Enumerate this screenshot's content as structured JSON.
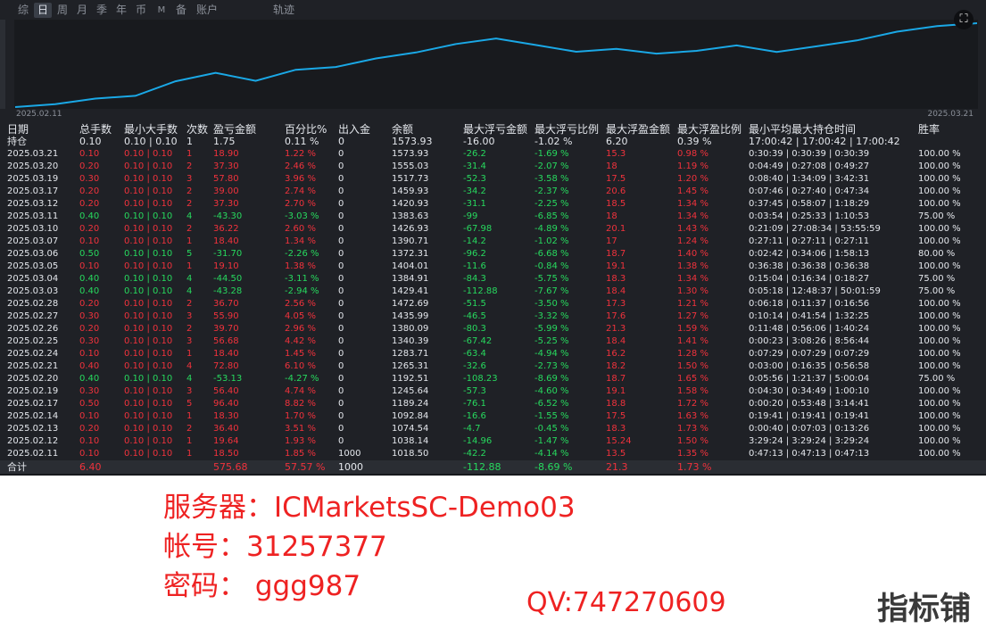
{
  "tabs": [
    {
      "label": "综",
      "active": false
    },
    {
      "label": "日",
      "active": true
    },
    {
      "label": "周",
      "active": false
    },
    {
      "label": "月",
      "active": false
    },
    {
      "label": "季",
      "active": false
    },
    {
      "label": "年",
      "active": false
    },
    {
      "label": "币",
      "active": false
    },
    {
      "label": "M",
      "active": false
    },
    {
      "label": "备",
      "active": false
    },
    {
      "label": "账户",
      "active": false
    }
  ],
  "chart_title": "轨迹",
  "chart_start_date": "2025.02.11",
  "chart_end_date": "2025.03.21",
  "expand_icon": "expand-icon",
  "chart_data": {
    "type": "line",
    "x": [
      "2025.02.11",
      "2025.02.12",
      "2025.02.13",
      "2025.02.14",
      "2025.02.17",
      "2025.02.19",
      "2025.02.20",
      "2025.02.21",
      "2025.02.24",
      "2025.02.25",
      "2025.02.26",
      "2025.02.27",
      "2025.02.28",
      "2025.03.03",
      "2025.03.04",
      "2025.03.05",
      "2025.03.06",
      "2025.03.07",
      "2025.03.10",
      "2025.03.11",
      "2025.03.12",
      "2025.03.17",
      "2025.03.19",
      "2025.03.20",
      "2025.03.21"
    ],
    "values": [
      1018.5,
      1038.14,
      1074.54,
      1092.84,
      1189.24,
      1245.64,
      1192.51,
      1265.31,
      1283.71,
      1340.39,
      1380.09,
      1435.99,
      1472.69,
      1429.41,
      1384.91,
      1404.01,
      1372.31,
      1390.71,
      1426.93,
      1383.63,
      1420.93,
      1459.93,
      1517.73,
      1555.03,
      1573.93
    ],
    "color": "#1aa8e6",
    "grid": false
  },
  "table": {
    "headers": [
      "日期",
      "总手数",
      "最小大手数",
      "次数",
      "盈亏金额",
      "百分比%",
      "出入金",
      "余额",
      "最大浮亏金额",
      "最大浮亏比例",
      "最大浮盈金额",
      "最大浮盈比例",
      "最小平均最大持仓时间",
      "胜率"
    ],
    "holding": [
      "持仓",
      "0.10",
      "0.10 | 0.10",
      "1",
      "1.75",
      "0.11 %",
      "0",
      "1573.93",
      "-16.00",
      "-1.02 %",
      "6.20",
      "0.39 %",
      "17:00:42 | 17:00:42 | 17:00:42",
      ""
    ],
    "rows": [
      [
        "2025.03.21",
        "0.10",
        "0.10 | 0.10",
        "1",
        "18.90",
        "1.22 %",
        "0",
        "1573.93",
        "-26.2",
        "-1.69 %",
        "15.3",
        "0.98 %",
        "0:30:39 | 0:30:39 | 0:30:39",
        "100.00 %"
      ],
      [
        "2025.03.20",
        "0.20",
        "0.10 | 0.10",
        "2",
        "37.30",
        "2.46 %",
        "0",
        "1555.03",
        "-31.4",
        "-2.07 %",
        "18",
        "1.19 %",
        "0:04:49 | 0:27:08 | 0:49:27",
        "100.00 %"
      ],
      [
        "2025.03.19",
        "0.30",
        "0.10 | 0.10",
        "3",
        "57.80",
        "3.96 %",
        "0",
        "1517.73",
        "-52.3",
        "-3.58 %",
        "17.5",
        "1.20 %",
        "0:08:40 | 1:34:09 | 3:42:31",
        "100.00 %"
      ],
      [
        "2025.03.17",
        "0.20",
        "0.10 | 0.10",
        "2",
        "39.00",
        "2.74 %",
        "0",
        "1459.93",
        "-34.2",
        "-2.37 %",
        "20.6",
        "1.45 %",
        "0:07:46 | 0:27:40 | 0:47:34",
        "100.00 %"
      ],
      [
        "2025.03.12",
        "0.20",
        "0.10 | 0.10",
        "2",
        "37.30",
        "2.70 %",
        "0",
        "1420.93",
        "-31.1",
        "-2.25 %",
        "18.5",
        "1.34 %",
        "0:37:45 | 0:58:07 | 1:18:29",
        "100.00 %"
      ],
      [
        "2025.03.11",
        "0.40",
        "0.10 | 0.10",
        "4",
        "-43.30",
        "-3.03 %",
        "0",
        "1383.63",
        "-99",
        "-6.85 %",
        "18",
        "1.34 %",
        "0:03:54 | 0:25:33 | 1:10:53",
        "75.00 %"
      ],
      [
        "2025.03.10",
        "0.20",
        "0.10 | 0.10",
        "2",
        "36.22",
        "2.60 %",
        "0",
        "1426.93",
        "-67.98",
        "-4.89 %",
        "20.1",
        "1.43 %",
        "0:21:09 | 27:08:34 | 53:55:59",
        "100.00 %"
      ],
      [
        "2025.03.07",
        "0.10",
        "0.10 | 0.10",
        "1",
        "18.40",
        "1.34 %",
        "0",
        "1390.71",
        "-14.2",
        "-1.02 %",
        "17",
        "1.24 %",
        "0:27:11 | 0:27:11 | 0:27:11",
        "100.00 %"
      ],
      [
        "2025.03.06",
        "0.50",
        "0.10 | 0.10",
        "5",
        "-31.70",
        "-2.26 %",
        "0",
        "1372.31",
        "-96.2",
        "-6.68 %",
        "18.7",
        "1.40 %",
        "0:02:42 | 0:34:06 | 1:58:13",
        "80.00 %"
      ],
      [
        "2025.03.05",
        "0.10",
        "0.10 | 0.10",
        "1",
        "19.10",
        "1.38 %",
        "0",
        "1404.01",
        "-11.6",
        "-0.84 %",
        "19.1",
        "1.38 %",
        "0:36:38 | 0:36:38 | 0:36:38",
        "100.00 %"
      ],
      [
        "2025.03.04",
        "0.40",
        "0.10 | 0.10",
        "4",
        "-44.50",
        "-3.11 %",
        "0",
        "1384.91",
        "-84.3",
        "-5.75 %",
        "18.3",
        "1.34 %",
        "0:15:04 | 0:16:34 | 0:18:27",
        "75.00 %"
      ],
      [
        "2025.03.03",
        "0.40",
        "0.10 | 0.10",
        "4",
        "-43.28",
        "-2.94 %",
        "0",
        "1429.41",
        "-112.88",
        "-7.67 %",
        "18.4",
        "1.30 %",
        "0:05:18 | 12:48:37 | 50:01:59",
        "75.00 %"
      ],
      [
        "2025.02.28",
        "0.20",
        "0.10 | 0.10",
        "2",
        "36.70",
        "2.56 %",
        "0",
        "1472.69",
        "-51.5",
        "-3.50 %",
        "17.3",
        "1.21 %",
        "0:06:18 | 0:11:37 | 0:16:56",
        "100.00 %"
      ],
      [
        "2025.02.27",
        "0.30",
        "0.10 | 0.10",
        "3",
        "55.90",
        "4.05 %",
        "0",
        "1435.99",
        "-46.5",
        "-3.32 %",
        "17.6",
        "1.27 %",
        "0:10:14 | 0:41:54 | 1:32:25",
        "100.00 %"
      ],
      [
        "2025.02.26",
        "0.20",
        "0.10 | 0.10",
        "2",
        "39.70",
        "2.96 %",
        "0",
        "1380.09",
        "-80.3",
        "-5.99 %",
        "21.3",
        "1.59 %",
        "0:11:48 | 0:56:06 | 1:40:24",
        "100.00 %"
      ],
      [
        "2025.02.25",
        "0.30",
        "0.10 | 0.10",
        "3",
        "56.68",
        "4.42 %",
        "0",
        "1340.39",
        "-67.42",
        "-5.25 %",
        "18.4",
        "1.41 %",
        "0:00:23 | 3:08:26 | 8:56:44",
        "100.00 %"
      ],
      [
        "2025.02.24",
        "0.10",
        "0.10 | 0.10",
        "1",
        "18.40",
        "1.45 %",
        "0",
        "1283.71",
        "-63.4",
        "-4.94 %",
        "16.2",
        "1.28 %",
        "0:07:29 | 0:07:29 | 0:07:29",
        "100.00 %"
      ],
      [
        "2025.02.21",
        "0.40",
        "0.10 | 0.10",
        "4",
        "72.80",
        "6.10 %",
        "0",
        "1265.31",
        "-32.6",
        "-2.73 %",
        "18.2",
        "1.50 %",
        "0:03:00 | 0:16:35 | 0:56:58",
        "100.00 %"
      ],
      [
        "2025.02.20",
        "0.40",
        "0.10 | 0.10",
        "4",
        "-53.13",
        "-4.27 %",
        "0",
        "1192.51",
        "-108.23",
        "-8.69 %",
        "18.7",
        "1.65 %",
        "0:05:56 | 1:21:37 | 5:00:04",
        "75.00 %"
      ],
      [
        "2025.02.19",
        "0.30",
        "0.10 | 0.10",
        "3",
        "56.40",
        "4.74 %",
        "0",
        "1245.64",
        "-57.3",
        "-4.60 %",
        "19.1",
        "1.58 %",
        "0:04:30 | 0:34:49 | 1:00:10",
        "100.00 %"
      ],
      [
        "2025.02.17",
        "0.50",
        "0.10 | 0.10",
        "5",
        "96.40",
        "8.82 %",
        "0",
        "1189.24",
        "-76.1",
        "-6.52 %",
        "18.8",
        "1.72 %",
        "0:00:20 | 0:53:48 | 3:14:41",
        "100.00 %"
      ],
      [
        "2025.02.14",
        "0.10",
        "0.10 | 0.10",
        "1",
        "18.30",
        "1.70 %",
        "0",
        "1092.84",
        "-16.6",
        "-1.55 %",
        "17.5",
        "1.63 %",
        "0:19:41 | 0:19:41 | 0:19:41",
        "100.00 %"
      ],
      [
        "2025.02.13",
        "0.20",
        "0.10 | 0.10",
        "2",
        "36.40",
        "3.51 %",
        "0",
        "1074.54",
        "-4.7",
        "-0.45 %",
        "18.3",
        "1.73 %",
        "0:00:40 | 0:07:03 | 0:13:26",
        "100.00 %"
      ],
      [
        "2025.02.12",
        "0.10",
        "0.10 | 0.10",
        "1",
        "19.64",
        "1.93 %",
        "0",
        "1038.14",
        "-14.96",
        "-1.47 %",
        "15.24",
        "1.50 %",
        "3:29:24 | 3:29:24 | 3:29:24",
        "100.00 %"
      ],
      [
        "2025.02.11",
        "0.10",
        "0.10 | 0.10",
        "1",
        "18.50",
        "1.85 %",
        "1000",
        "1018.50",
        "-42.2",
        "-4.14 %",
        "13.5",
        "1.35 %",
        "0:47:13 | 0:47:13 | 0:47:13",
        "100.00 %"
      ]
    ],
    "total": [
      "合计",
      "6.40",
      "",
      "",
      "575.68",
      "57.57 %",
      "1000",
      "",
      "-112.88",
      "-8.69 %",
      "21.3",
      "1.73 %",
      "",
      ""
    ]
  },
  "colors": {
    "profit": "#f0323c",
    "loss": "#27d95e",
    "neutral": "#e4e7ec"
  },
  "overlay": {
    "server": "服务器：ICMarketsSC-Demo03",
    "account": "帐号：31257377",
    "password": "密码：  ggg987",
    "qv": "QV:747270609",
    "brand": "指标铺"
  }
}
